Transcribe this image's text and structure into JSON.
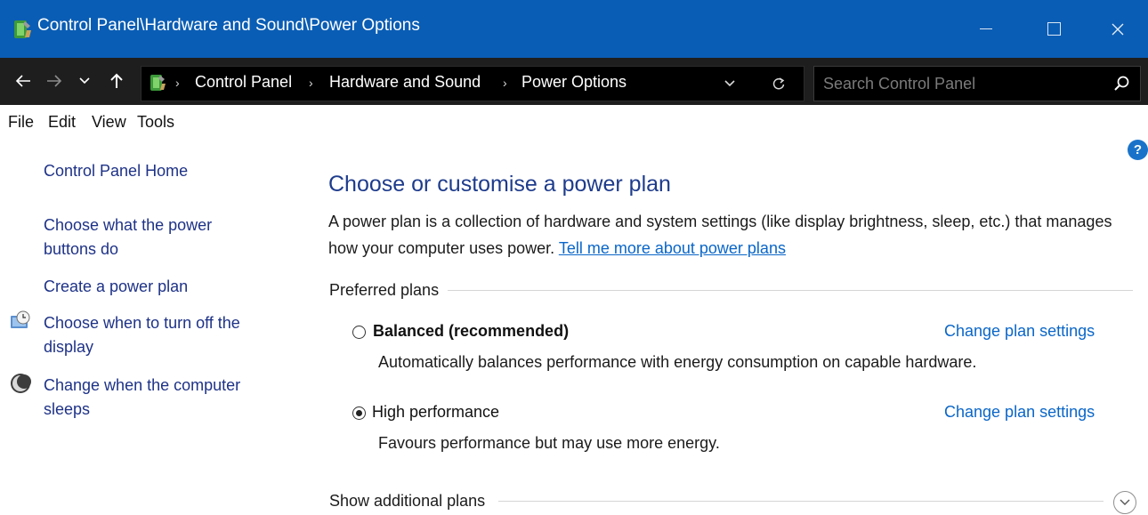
{
  "window": {
    "title": "Control Panel\\Hardware and Sound\\Power Options",
    "app_icon": "control-panel-power-icon"
  },
  "address_bar": {
    "breadcrumbs": [
      "Control Panel",
      "Hardware and Sound",
      "Power Options"
    ],
    "search_placeholder": "Search Control Panel"
  },
  "menu": {
    "items": [
      "File",
      "Edit",
      "View",
      "Tools"
    ]
  },
  "sidebar": {
    "home": "Control Panel Home",
    "links": [
      {
        "line1": "Choose what the power",
        "line2": "buttons do"
      },
      {
        "line1": "Create a power plan"
      },
      {
        "line1": "Choose when to turn off the",
        "line2": "display",
        "icon": "display-clock-icon"
      },
      {
        "line1": "Change when the computer",
        "line2": "sleeps",
        "icon": "moon-sleep-icon"
      }
    ]
  },
  "main": {
    "title": "Choose or customise a power plan",
    "intro_text": "A power plan is a collection of hardware and system settings (like display brightness, sleep, etc.) that manages how your computer uses power.",
    "intro_link": "Tell me more about power plans",
    "preferred_header": "Preferred plans",
    "plans": [
      {
        "name": "Balanced (recommended)",
        "description": "Automatically balances performance with energy consumption on capable hardware.",
        "selected": false,
        "link": "Change plan settings"
      },
      {
        "name": "High performance",
        "description": "Favours performance but may use more energy.",
        "selected": true,
        "link": "Change plan settings"
      }
    ],
    "additional_header": "Show additional plans"
  },
  "colors": {
    "title_bar": "#0a5db4",
    "address_bar": "#1e1e1e",
    "link": "#0a66c8",
    "nav_link": "#1e3287",
    "heading": "#1e3c8c"
  }
}
